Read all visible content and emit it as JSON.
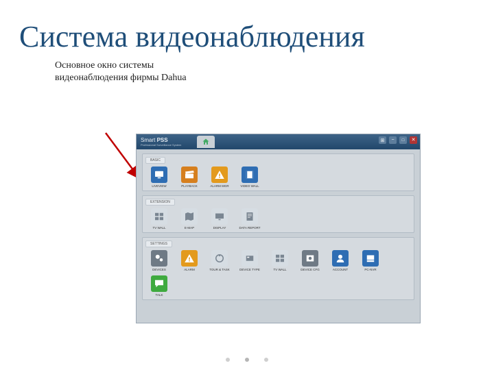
{
  "title": "Система видеонаблюдения",
  "caption_l1": "Основное окно системы",
  "caption_l2": "видеонаблюдения фирмы Dahua",
  "app": {
    "logo_line1_a": "Smart ",
    "logo_line1_b": "PSS",
    "logo_line2": "Professional Surveillance System",
    "sections": {
      "basic": {
        "title": "BASIC",
        "items": [
          {
            "label": "LIVEVIEW",
            "icon": "monitor",
            "bg": "#2e6db3"
          },
          {
            "label": "PLAYBACK",
            "icon": "clapper",
            "bg": "#d67f1e"
          },
          {
            "label": "ALARM MGR",
            "icon": "warning",
            "bg": "#e39a1d"
          },
          {
            "label": "VIDEO WALL",
            "icon": "film",
            "bg": "#2e6db3"
          }
        ]
      },
      "extension": {
        "title": "EXTENSION",
        "items": [
          {
            "label": "TV WALL",
            "icon": "wall",
            "bg": "#d6dde3"
          },
          {
            "label": "E-MAP",
            "icon": "emap",
            "bg": "#d6dde3"
          },
          {
            "label": "DISPLAY",
            "icon": "display",
            "bg": "#d6dde3"
          },
          {
            "label": "DATA REPORT",
            "icon": "report",
            "bg": "#d6dde3"
          }
        ]
      },
      "settings": {
        "title": "SETTINGS",
        "items": [
          {
            "label": "DEVICES",
            "icon": "gears",
            "bg": "#6f7a85"
          },
          {
            "label": "ALARM",
            "icon": "warning",
            "bg": "#e39a1d"
          },
          {
            "label": "TOUR & TASK",
            "icon": "tour",
            "bg": "#d6dde3"
          },
          {
            "label": "DEVICE TYPE",
            "icon": "devtype",
            "bg": "#d6dde3"
          },
          {
            "label": "TV WALL",
            "icon": "wall",
            "bg": "#d6dde3"
          },
          {
            "label": "DEVICE CFG",
            "icon": "devcfg",
            "bg": "#6f7a85"
          },
          {
            "label": "ACCOUNT",
            "icon": "account",
            "bg": "#2e6db3"
          },
          {
            "label": "PC-NVR",
            "icon": "pcnvr",
            "bg": "#2e6db3"
          },
          {
            "label": "TALK",
            "icon": "talk",
            "bg": "#3faa3f"
          }
        ]
      }
    }
  }
}
